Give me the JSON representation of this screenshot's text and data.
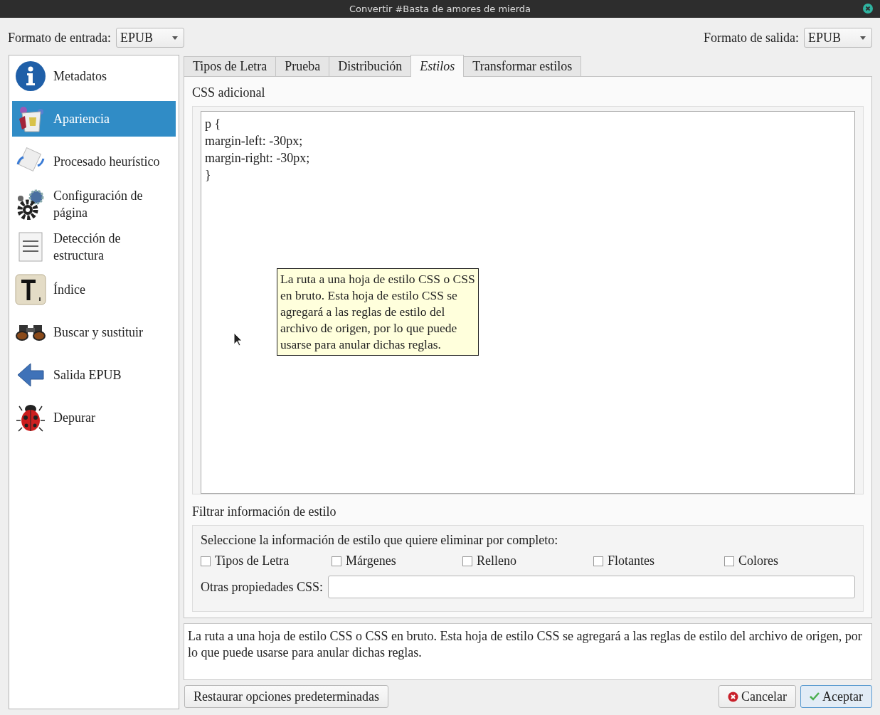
{
  "window": {
    "title": "Convertir #Basta de amores de mierda"
  },
  "input_format": {
    "label": "Formato de entrada:",
    "value": "EPUB"
  },
  "output_format": {
    "label": "Formato de salida:",
    "value": "EPUB"
  },
  "sidebar": {
    "items": [
      {
        "label": "Metadatos",
        "selected": false
      },
      {
        "label": "Apariencia",
        "selected": true
      },
      {
        "label": "Procesado heurístico",
        "selected": false
      },
      {
        "label": "Configuración de página",
        "selected": false
      },
      {
        "label": "Detección de estructura",
        "selected": false
      },
      {
        "label": "Índice",
        "selected": false
      },
      {
        "label": "Buscar y sustituir",
        "selected": false
      },
      {
        "label": "Salida EPUB",
        "selected": false
      },
      {
        "label": "Depurar",
        "selected": false
      }
    ]
  },
  "tabs": [
    {
      "label": "Tipos de Letra",
      "selected": false
    },
    {
      "label": "Prueba",
      "selected": false
    },
    {
      "label": "Distribución",
      "selected": false
    },
    {
      "label": "Estilos",
      "selected": true
    },
    {
      "label": "Transformar estilos",
      "selected": false
    }
  ],
  "extra_css": {
    "title": "CSS adicional",
    "lines": [
      "p {",
      "margin-left: -30px;",
      "margin-right: -30px;",
      "}"
    ]
  },
  "tooltip": "La ruta a una hoja de estilo CSS o CSS en bruto. Esta hoja de estilo CSS se agregará a las reglas de estilo del archivo de origen, por lo que puede usarse para anular dichas reglas.",
  "filter": {
    "title": "Filtrar información de estilo",
    "prompt": "Seleccione la información de estilo que quiere eliminar por completo:",
    "options": [
      {
        "label": "Tipos de Letra",
        "checked": false
      },
      {
        "label": "Márgenes",
        "checked": false
      },
      {
        "label": "Relleno",
        "checked": false
      },
      {
        "label": "Flotantes",
        "checked": false
      },
      {
        "label": "Colores",
        "checked": false
      }
    ],
    "other": {
      "label": "Otras propiedades CSS:"
    }
  },
  "description": "La ruta a una hoja de estilo CSS o CSS en bruto. Esta hoja de estilo CSS se agregará a las reglas de estilo del archivo de origen, por lo que puede usarse para anular dichas reglas.",
  "buttons": {
    "restore": "Restaurar opciones predeterminadas",
    "cancel": "Cancelar",
    "accept": "Aceptar"
  }
}
